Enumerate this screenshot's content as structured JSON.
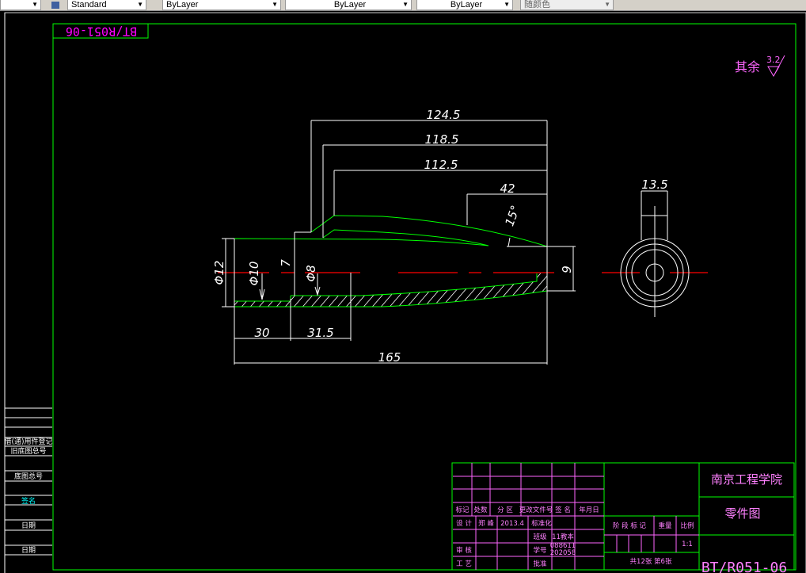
{
  "toolbar": {
    "text_style": "Standard",
    "layer": "ByLayer",
    "linetype": "ByLayer",
    "lineweight": "ByLayer",
    "plot_style": "随颜色"
  },
  "drawing": {
    "mirrored_code": "BT/R051-06",
    "surface_note": "其余",
    "roughness": "3.2",
    "dimensions": {
      "d124": "124.5",
      "d118": "118.5",
      "d112": "112.5",
      "d42": "42",
      "angle": "15°",
      "phi12": "Φ12",
      "phi10": "Φ10",
      "phi8": "Φ8",
      "d7": "7",
      "d9": "9",
      "d30": "30",
      "d31": "31.5",
      "d165": "165",
      "d13": "13.5"
    }
  },
  "left_strip": {
    "items": [
      "借(通)用件登记",
      "旧底图总号",
      "底图总号",
      "签名",
      "日期",
      "日期"
    ]
  },
  "title_block": {
    "header": [
      "标记",
      "处数",
      "分 区",
      "更改文件号",
      "签 名",
      "年月日"
    ],
    "design_label": "设 计",
    "designer": "郑 峰",
    "date": "2013.4",
    "standard_label": "标准化",
    "class_label": "班级",
    "class_value": "11教本",
    "review_label": "审 核",
    "student_no_label": "学号",
    "student_no_1": "088611",
    "student_no_2": "202058",
    "process_label": "工 艺",
    "approve_label": "批准",
    "stage_label": "阶 段 标 记",
    "weight_label": "重量",
    "scale_label": "比例",
    "scale": "1:1",
    "sheets": "共12张  第6张",
    "school": "南京工程学院",
    "drawing_title": "零件图",
    "drawing_code": "BT/R051-06"
  },
  "colors": {
    "frame": "#00ff00",
    "table": "#ff66ff",
    "centerline": "#ff0000",
    "background": "#000000"
  }
}
